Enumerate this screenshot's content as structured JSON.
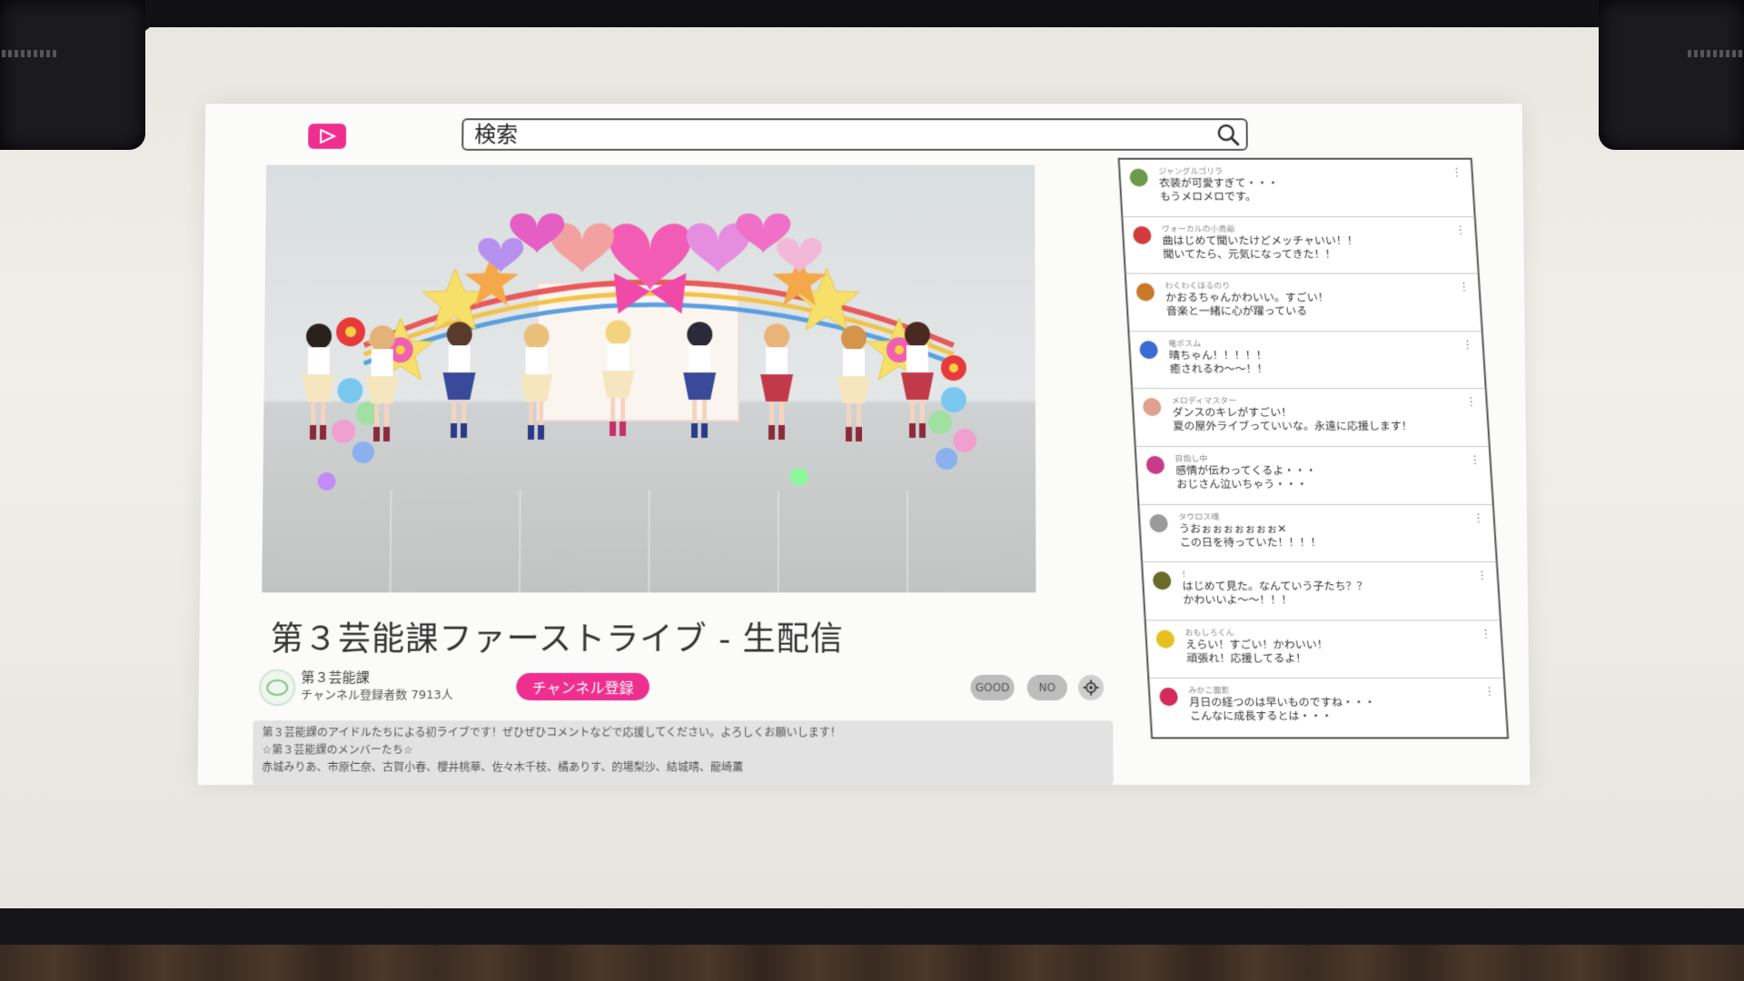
{
  "search": {
    "placeholder": "検索"
  },
  "video": {
    "title": "第３芸能課ファーストライブ - 生配信"
  },
  "channel": {
    "name": "第３芸能課",
    "subscribers": "チャンネル登録者数 7913人",
    "subscribe_label": "チャンネル登録"
  },
  "actions": {
    "good": "GOOD",
    "no": "NO"
  },
  "description": {
    "line1": "第３芸能課のアイドルたちによる初ライブです！ぜひぜひコメントなどで応援してください。よろしくお願いします！",
    "line2": "☆第３芸能課のメンバーたち☆",
    "line3": "赤城みりあ、市原仁奈、古賀小春、櫻井桃華、佐々木千枝、橘ありす、的場梨沙、結城晴、龍崎薫"
  },
  "comments": [
    {
      "user": "ジャングルゴリラ",
      "text": "衣装が可愛すぎて・・・\nもうメロメロです。",
      "avatar_color": "#6a9a4a"
    },
    {
      "user": "ヴォーカルの小鳥爺",
      "text": "曲はじめて聞いたけどメッチャいい！！\n聞いてたら、元気になってきた！！",
      "avatar_color": "#d43a3a"
    },
    {
      "user": "わくわくほるのり",
      "text": "かおるちゃんかわいい。すごい！\n音楽と一緒に心が躍っている",
      "avatar_color": "#c87a2a"
    },
    {
      "user": "竜ボスム",
      "text": "晴ちゃん！！！！！\n癒されるわ〜〜！！",
      "avatar_color": "#3a6ad4"
    },
    {
      "user": "メロディマスター",
      "text": "ダンスのキレがすごい！\n夏の屋外ライブっていいな。永遠に応援します！",
      "avatar_color": "#e0a090"
    },
    {
      "user": "目指し中",
      "text": "感情が伝わってくるよ・・・\nおじさん泣いちゃう・・・",
      "avatar_color": "#c83a8a"
    },
    {
      "user": "タウロス魂",
      "text": "うおぉぉぉぉぉぉぉ✕\nこの日を待っていた！！！！",
      "avatar_color": "#9a9a9a"
    },
    {
      "user": "！",
      "text": "はじめて見た。なんていう子たち？？\nかわいいよ〜〜！！！",
      "avatar_color": "#6a6a2a"
    },
    {
      "user": "おもしろくん",
      "text": "えらい！すごい！かわいい！\n頑張れ！応援してるよ！",
      "avatar_color": "#e6c020"
    },
    {
      "user": "みかこ面影",
      "text": "月日の経つのは早いものですね・・・\nこんなに成長するとは・・・",
      "avatar_color": "#d42a5a"
    }
  ],
  "colors": {
    "brand": "#ee2f8f",
    "frame": "#111114"
  },
  "icons": {
    "logo": "play-logo-icon",
    "search": "search-icon",
    "settings": "gear-icon",
    "comment_menu": "kebab-menu-icon"
  }
}
